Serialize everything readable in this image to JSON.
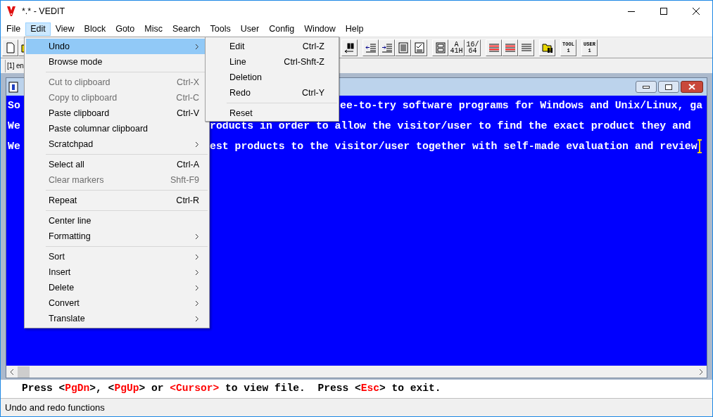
{
  "window": {
    "title": "*.* - VEDIT"
  },
  "menubar": [
    {
      "label": "File",
      "selected": false
    },
    {
      "label": "Edit",
      "selected": true
    },
    {
      "label": "View",
      "selected": false
    },
    {
      "label": "Block",
      "selected": false
    },
    {
      "label": "Goto",
      "selected": false
    },
    {
      "label": "Misc",
      "selected": false
    },
    {
      "label": "Search",
      "selected": false
    },
    {
      "label": "Tools",
      "selected": false
    },
    {
      "label": "User",
      "selected": false
    },
    {
      "label": "Config",
      "selected": false
    },
    {
      "label": "Window",
      "selected": false
    },
    {
      "label": "Help",
      "selected": false
    }
  ],
  "toolbar": {
    "groups": [
      [
        {
          "kind": "new-document"
        },
        {
          "kind": "folder"
        }
      ],
      [
        {
          "kind": "binoculars"
        }
      ],
      [
        {
          "kind": "outdent"
        },
        {
          "kind": "indent"
        },
        {
          "kind": "document"
        },
        {
          "kind": "checklist"
        }
      ],
      [
        {
          "kind": "frame"
        },
        {
          "kind": "label",
          "label": "A 41H"
        },
        {
          "kind": "label",
          "label": "16/ 64"
        }
      ],
      [
        {
          "kind": "red-lines"
        },
        {
          "kind": "red-lines"
        },
        {
          "kind": "lines"
        }
      ],
      [
        {
          "kind": "folder-binoculars"
        }
      ],
      [
        {
          "kind": "small-label",
          "label": "TOOL 1"
        }
      ],
      [
        {
          "kind": "small-label",
          "label": "USER 1"
        }
      ]
    ]
  },
  "file_tab": {
    "label": "[1] en"
  },
  "editor": {
    "lines": [
      {
        "left": "So",
        "right": "ee-to-try software programs for Windows and Unix/Linux, ga"
      },
      {
        "left": "We",
        "right": "roducts in order to allow the visitor/user to find the exact product they and"
      },
      {
        "left": "We",
        "right": "est products to the visitor/user together with self-made evaluation and review"
      }
    ]
  },
  "edit_menu": [
    {
      "kind": "item",
      "label": "Undo",
      "submenu": true,
      "disabled": false,
      "selected": true
    },
    {
      "kind": "item",
      "label": "Browse mode",
      "submenu": false,
      "disabled": false,
      "selected": false
    },
    {
      "kind": "separator"
    },
    {
      "kind": "item",
      "label": "Cut to clipboard",
      "shortcut": "Ctrl-X",
      "submenu": false,
      "disabled": true,
      "selected": false
    },
    {
      "kind": "item",
      "label": "Copy to clipboard",
      "shortcut": "Ctrl-C",
      "submenu": false,
      "disabled": true,
      "selected": false
    },
    {
      "kind": "item",
      "label": "Paste clipboard",
      "shortcut": "Ctrl-V",
      "submenu": false,
      "disabled": false,
      "selected": false
    },
    {
      "kind": "item",
      "label": "Paste columnar clipboard",
      "submenu": false,
      "disabled": false,
      "selected": false
    },
    {
      "kind": "item",
      "label": "Scratchpad",
      "submenu": true,
      "disabled": false,
      "selected": false
    },
    {
      "kind": "separator"
    },
    {
      "kind": "item",
      "label": "Select all",
      "shortcut": "Ctrl-A",
      "submenu": false,
      "disabled": false,
      "selected": false
    },
    {
      "kind": "item",
      "label": "Clear markers",
      "shortcut": "Shft-F9",
      "submenu": false,
      "disabled": true,
      "selected": false
    },
    {
      "kind": "separator"
    },
    {
      "kind": "item",
      "label": "Repeat",
      "shortcut": "Ctrl-R",
      "submenu": false,
      "disabled": false,
      "selected": false
    },
    {
      "kind": "separator"
    },
    {
      "kind": "item",
      "label": "Center line",
      "submenu": false,
      "disabled": false,
      "selected": false
    },
    {
      "kind": "item",
      "label": "Formatting",
      "submenu": true,
      "disabled": false,
      "selected": false
    },
    {
      "kind": "separator"
    },
    {
      "kind": "item",
      "label": "Sort",
      "submenu": true,
      "disabled": false,
      "selected": false
    },
    {
      "kind": "item",
      "label": "Insert",
      "submenu": true,
      "disabled": false,
      "selected": false
    },
    {
      "kind": "item",
      "label": "Delete",
      "submenu": true,
      "disabled": false,
      "selected": false
    },
    {
      "kind": "item",
      "label": "Convert",
      "submenu": true,
      "disabled": false,
      "selected": false
    },
    {
      "kind": "item",
      "label": "Translate",
      "submenu": true,
      "disabled": false,
      "selected": false
    }
  ],
  "undo_submenu": [
    {
      "kind": "item",
      "label": "Edit",
      "shortcut": "Ctrl-Z"
    },
    {
      "kind": "item",
      "label": "Line",
      "shortcut": "Ctrl-Shft-Z"
    },
    {
      "kind": "item",
      "label": "Deletion"
    },
    {
      "kind": "item",
      "label": "Redo",
      "shortcut": "Ctrl-Y"
    },
    {
      "kind": "separator"
    },
    {
      "kind": "item",
      "label": "Reset"
    }
  ],
  "message_line": [
    {
      "text": "Press <",
      "highlight": false
    },
    {
      "text": "PgDn",
      "highlight": true
    },
    {
      "text": ">, <",
      "highlight": false
    },
    {
      "text": "PgUp",
      "highlight": true
    },
    {
      "text": "> or ",
      "highlight": false
    },
    {
      "text": "<Cursor>",
      "highlight": true
    },
    {
      "text": " to view file.  Press <",
      "highlight": false
    },
    {
      "text": "Esc",
      "highlight": true
    },
    {
      "text": "> to exit.",
      "highlight": false
    }
  ],
  "status_bar": {
    "text": "Undo and redo functions"
  }
}
